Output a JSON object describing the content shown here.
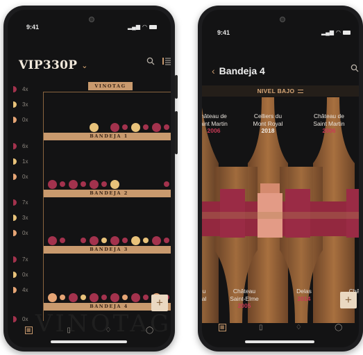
{
  "status": {
    "time": "9:41",
    "signal": "...l"
  },
  "left": {
    "title": "VIP330P",
    "brand_label": "VINOTAG",
    "watermark": "VINOTAG",
    "shelves": [
      {
        "label": "BANDEJA 1",
        "counts": [
          {
            "color": "#a3324d",
            "value": "4x"
          },
          {
            "color": "#e8c27a",
            "value": "3x"
          },
          {
            "color": "#e6a575",
            "value": "0x"
          }
        ]
      },
      {
        "label": "BANDEJA 2",
        "counts": [
          {
            "color": "#a3324d",
            "value": "6x"
          },
          {
            "color": "#e8c27a",
            "value": "1x"
          },
          {
            "color": "#e6a575",
            "value": "0x"
          }
        ]
      },
      {
        "label": "BANDEJA 3",
        "counts": [
          {
            "color": "#a3324d",
            "value": "7x"
          },
          {
            "color": "#e8c27a",
            "value": "3x"
          },
          {
            "color": "#e6a575",
            "value": "0x"
          }
        ]
      },
      {
        "label": "BANDEJA 4",
        "counts": [
          {
            "color": "#a3324d",
            "value": "7x"
          },
          {
            "color": "#e8c27a",
            "value": "0x"
          },
          {
            "color": "#e6a575",
            "value": "4x"
          }
        ]
      }
    ],
    "extra_count": "0x",
    "fab": "+"
  },
  "right": {
    "title": "Bandeja 4",
    "level": "NIVEL BAJO",
    "top_wines": [
      {
        "name": "hâteau de\naint Martin",
        "vintage": "2006"
      },
      {
        "name": "Celliers du\nMont Royal",
        "vintage": "2018"
      },
      {
        "name": "Château de\nSaint Martin",
        "vintage": "2006"
      }
    ],
    "bottom_wines": [
      {
        "name": "u\nal",
        "vintage": ""
      },
      {
        "name": "Château\nSaint-Elme",
        "vintage": "2005"
      },
      {
        "name": "Delas",
        "vintage": "2014"
      },
      {
        "name": "Châte",
        "vintage": ""
      }
    ],
    "fab": "+"
  },
  "colors": {
    "red_wine": "#a3324d",
    "white_wine": "#e8c27a",
    "rose_wine": "#e6a575",
    "shelf": "#c99a6e",
    "background": "#131314"
  },
  "icons": {
    "chevron": "chevron-down-icon",
    "search": "search-icon",
    "menu": "list-icon",
    "back": "chevron-left-icon",
    "cellar_tab": "cellar-icon",
    "bottle_tab": "bottle-icon",
    "bell_tab": "bell-icon",
    "user_tab": "user-icon"
  }
}
